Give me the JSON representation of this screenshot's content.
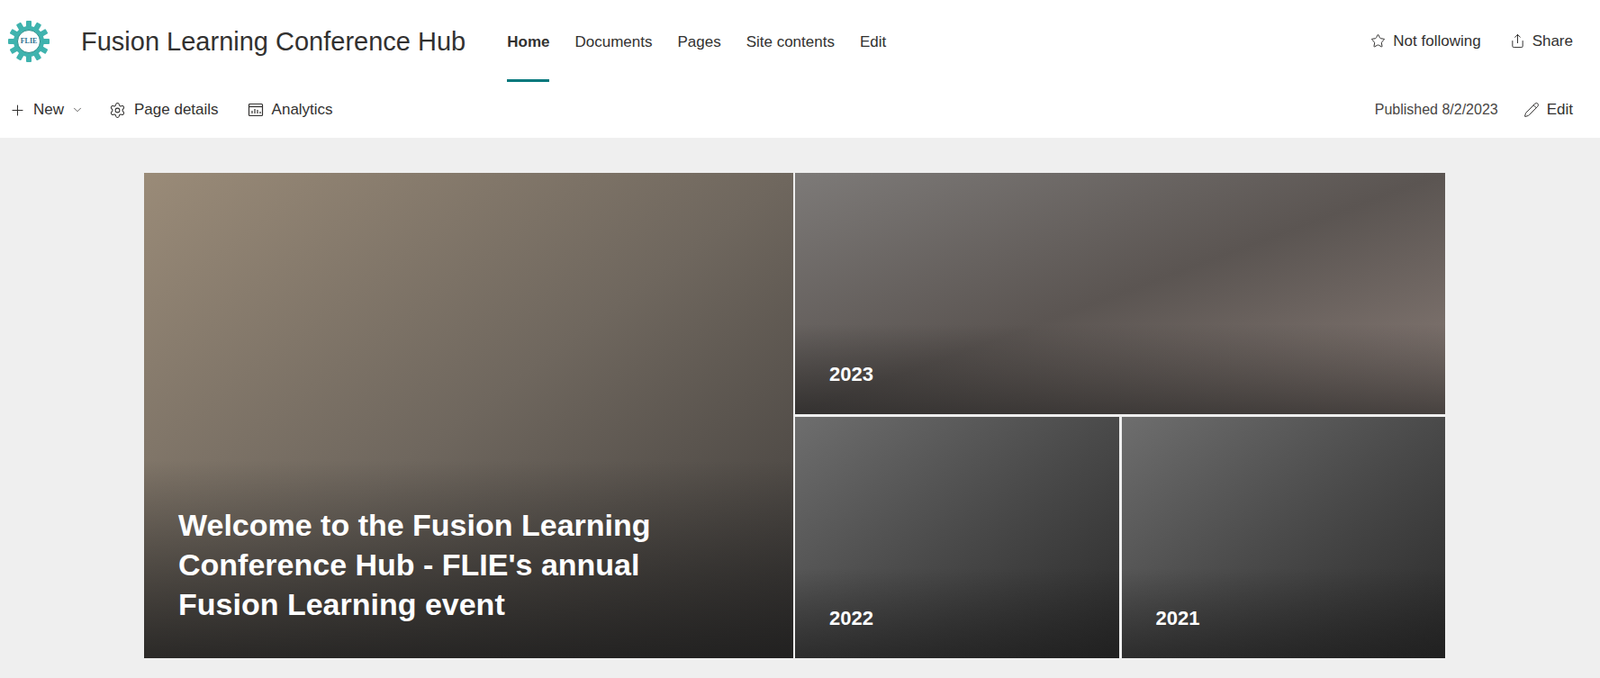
{
  "site": {
    "logo": "FLIE",
    "title": "Fusion Learning Conference Hub"
  },
  "nav": [
    {
      "label": "Home",
      "selected": true
    },
    {
      "label": "Documents",
      "selected": false
    },
    {
      "label": "Pages",
      "selected": false
    },
    {
      "label": "Site contents",
      "selected": false
    },
    {
      "label": "Edit",
      "selected": false
    }
  ],
  "header_actions": {
    "follow": "Not following",
    "share": "Share"
  },
  "command_bar": {
    "new": "New",
    "page_details": "Page details",
    "analytics": "Analytics",
    "published": "Published 8/2/2023",
    "edit": "Edit"
  },
  "hero": {
    "tiles": [
      {
        "kind": "main",
        "label": "Welcome to the Fusion Learning Conference Hub - FLIE's annual Fusion Learning event"
      },
      {
        "kind": "wide",
        "label": "2023"
      },
      {
        "kind": "small",
        "label": "2022"
      },
      {
        "kind": "small",
        "label": "2021"
      }
    ]
  }
}
